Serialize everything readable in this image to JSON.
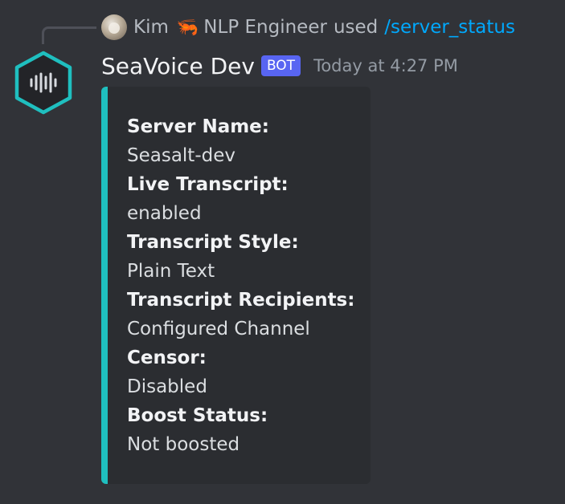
{
  "interaction": {
    "user_name": "Kim",
    "user_emoji": "🦐",
    "user_role": "NLP Engineer",
    "used_text": "used",
    "command": "/server_status"
  },
  "message": {
    "bot_name": "SeaVoice Dev",
    "bot_tag": "BOT",
    "timestamp": "Today at 4:27 PM"
  },
  "embed": {
    "accent_color": "#1fbfbf",
    "fields": [
      {
        "name": "Server Name:",
        "value": "Seasalt-dev"
      },
      {
        "name": "Live Transcript:",
        "value": "enabled"
      },
      {
        "name": "Transcript Style:",
        "value": "Plain Text"
      },
      {
        "name": "Transcript Recipients:",
        "value": "Configured Channel"
      },
      {
        "name": "Censor:",
        "value": "Disabled"
      },
      {
        "name": "Boost Status:",
        "value": "Not boosted"
      }
    ]
  },
  "colors": {
    "background": "#313338",
    "embed_background": "#2b2d31",
    "bot_tag": "#5865f2",
    "command_link": "#00a8fc",
    "avatar_hexagon": "#1fbfbf"
  }
}
